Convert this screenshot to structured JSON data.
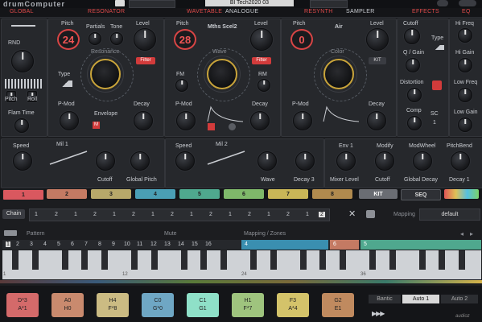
{
  "app": {
    "title": "drumComputer",
    "preset": "Bl Tech2020 03"
  },
  "sections": [
    "GLOBAL",
    "RESONATOR",
    "WAVETABLE",
    "ANALOGUE",
    "RESYNTH",
    "SAMPLER",
    "EFFECTS",
    "EQ"
  ],
  "global": {
    "rnd": "RND",
    "pitch": "Pitch",
    "roll": "Roll",
    "flam": "Flam Time"
  },
  "res": {
    "pitch_label": "Pitch",
    "pitch_value": "24",
    "partials": "Partials",
    "tone": "Tone",
    "level": "Level",
    "resonance": "Resonance",
    "filter": "Filter",
    "type": "Type",
    "pmod": "P-Mod",
    "envelope": "Envelope",
    "decay": "Decay",
    "m": "M"
  },
  "wav": {
    "pitch_label": "Pitch",
    "pitch_value": "28",
    "name": "Mths Scel2",
    "level": "Level",
    "wave": "Wave",
    "filter": "Filter",
    "fm": "FM",
    "rm": "RM",
    "pmod": "P-Mod",
    "decay": "Decay"
  },
  "ana": {
    "pitch_label": "Pitch",
    "pitch_value": "0",
    "name": "Air",
    "level": "Level",
    "color": "Color",
    "kit": "KIT",
    "pmod": "P-Mod",
    "decay": "Decay"
  },
  "fx": {
    "cutoff": "Cutoff",
    "type": "Type",
    "qgain": "Q / Gain",
    "distortion": "Distortion",
    "comp": "Comp",
    "sc": "SC",
    "sc_val": "1"
  },
  "eq": {
    "hifreq": "Hi Freq",
    "higain": "Hi Gain",
    "lowfreq": "Low Freq",
    "lowgain": "Low Gain"
  },
  "mods": {
    "mod1": "Mil 1",
    "mod2": "Mil 2",
    "speed": "Speed",
    "cutoff": "Cutoff",
    "globalpitch": "Global Pitch",
    "wave": "Wave",
    "decay3": "Decay 3",
    "env1": "Env 1",
    "modify": "Modify",
    "modwheel": "ModWheel",
    "pitchbend": "PitchBend",
    "mixerlevel": "Mixer Level",
    "cutoff2": "Cutoff",
    "globaldecay": "Global Decay",
    "decay1": "Decay 1"
  },
  "tracks": [
    {
      "n": "1",
      "c": "#d9585f"
    },
    {
      "n": "2",
      "c": "#c47a63"
    },
    {
      "n": "3",
      "c": "#b7a86a"
    },
    {
      "n": "4",
      "c": "#4a9fb5"
    },
    {
      "n": "5",
      "c": "#4fa88e"
    },
    {
      "n": "6",
      "c": "#7fb86a"
    },
    {
      "n": "7",
      "c": "#c9b657"
    },
    {
      "n": "8",
      "c": "#b08a4e"
    }
  ],
  "kit_label": "KIT",
  "seq_label": "SEQ",
  "chain": {
    "label": "Chain",
    "values": [
      "1",
      "2",
      "1",
      "2",
      "1",
      "2",
      "1",
      "2",
      "1",
      "2",
      "1",
      "2",
      "1",
      "2",
      "1",
      "2"
    ],
    "mapping_label": "Mapping",
    "mapping_value": "default"
  },
  "pattern": {
    "pattern_label": "Pattern",
    "mute_label": "Mute",
    "mapping_label": "Mapping / Zones",
    "steps": [
      "1",
      "2",
      "3",
      "4",
      "5",
      "6",
      "7",
      "8",
      "9",
      "10",
      "11",
      "12",
      "13",
      "14",
      "15",
      "16"
    ],
    "zones": [
      "4",
      "6",
      "5"
    ],
    "marks": [
      "1",
      "12",
      "24",
      "36"
    ]
  },
  "drums": [
    {
      "a": "D*3",
      "b": "A*1",
      "c": "#d46a6a"
    },
    {
      "a": "A0",
      "b": "H0",
      "c": "#c98a6e"
    },
    {
      "a": "H4",
      "b": "F*8",
      "c": "#cbbb83"
    },
    {
      "a": "C0",
      "b": "G*0",
      "c": "#6fa7c4"
    },
    {
      "a": "C1",
      "b": "G1",
      "c": "#8fe0c8"
    },
    {
      "a": "H1",
      "b": "F*7",
      "c": "#9fc47e"
    },
    {
      "a": "F3",
      "b": "A*4",
      "c": "#d4c36a"
    },
    {
      "a": "G2",
      "b": "E1",
      "c": "#c08a5f"
    }
  ],
  "bottom": {
    "btn1": "Bantic",
    "btn2": "Auto 1",
    "btn3": "Auto 2",
    "logo": "audioz"
  }
}
